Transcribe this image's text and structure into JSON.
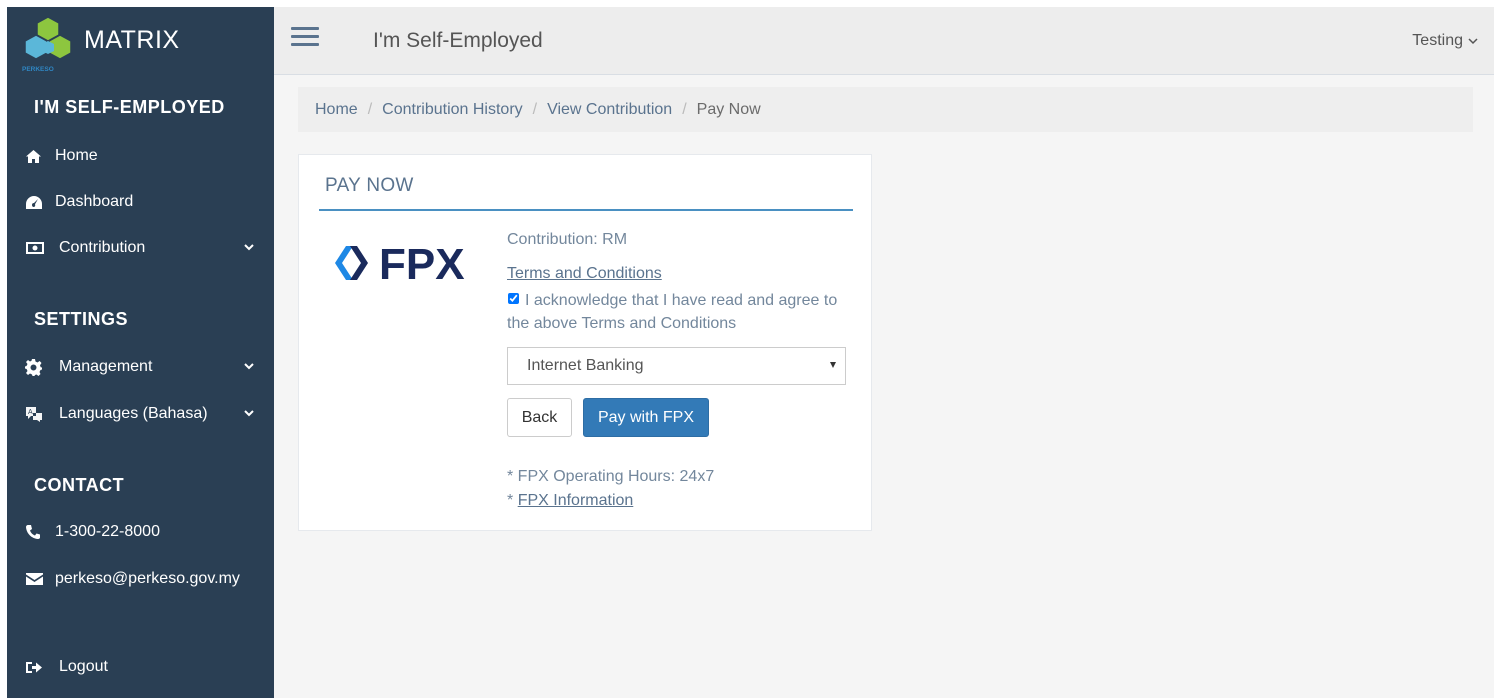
{
  "brand": {
    "name": "MATRIX",
    "logo_sub": "PERKESO"
  },
  "sidebar": {
    "section_main": "I'M SELF-EMPLOYED",
    "home": "Home",
    "dashboard": "Dashboard",
    "contribution": "Contribution",
    "section_settings": "SETTINGS",
    "management": "Management",
    "languages": "Languages (Bahasa)",
    "section_contact": "CONTACT",
    "phone": "1-300-22-8000",
    "email": "perkeso@perkeso.gov.my",
    "logout": "Logout"
  },
  "topbar": {
    "title": "I'm Self-Employed",
    "user": "Testing"
  },
  "breadcrumb": {
    "home": "Home",
    "history": "Contribution History",
    "view": "View Contribution",
    "current": "Pay Now",
    "separator": "/"
  },
  "panel": {
    "title": "PAY NOW",
    "logo_text": "FPX",
    "contribution": "Contribution: RM",
    "terms_link": "Terms and Conditions",
    "ack_text": "I acknowledge that I have read and agree to the above Terms and Conditions",
    "ack_checked": true,
    "payment_method": "Internet Banking",
    "back_label": "Back",
    "pay_label": "Pay with FPX",
    "hours": "* FPX Operating Hours: 24x7",
    "info_prefix": "*",
    "info_link": "FPX Information"
  },
  "colors": {
    "sidebar_bg": "#2a3f54",
    "accent": "#337ab7",
    "logo_green": "#8dc63f",
    "fpx_navy": "#1a2a5c",
    "fpx_blue": "#1e88e5"
  }
}
